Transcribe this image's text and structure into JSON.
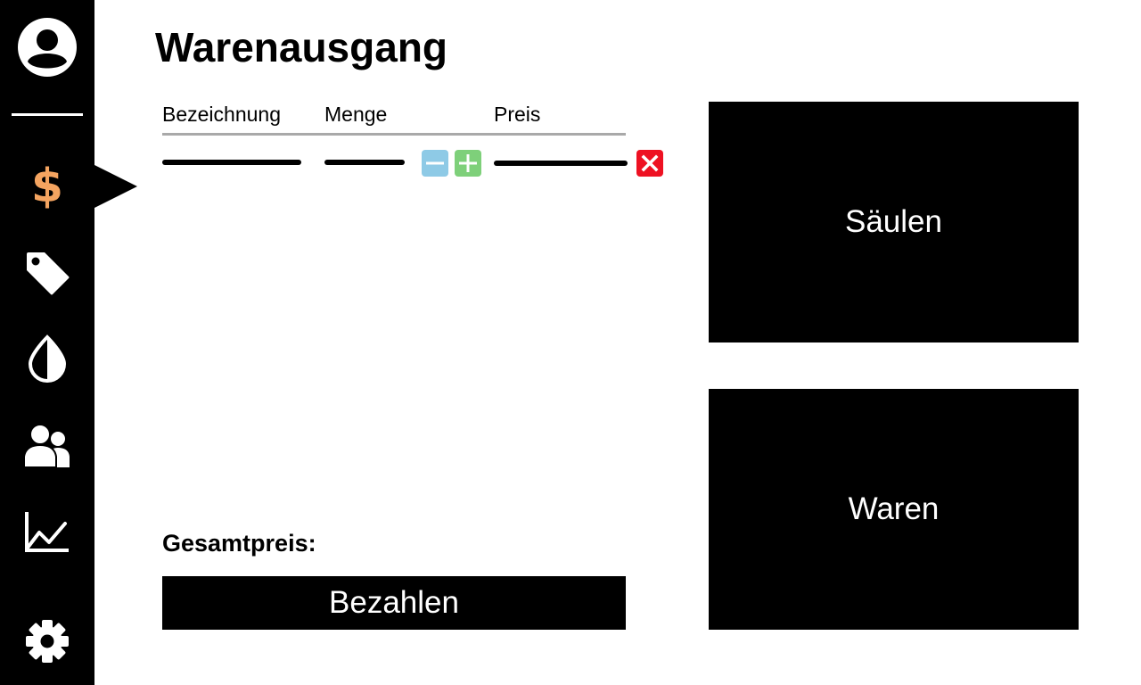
{
  "title": "Warenausgang",
  "colors": {
    "sidebar": "#000000",
    "active_icon": "#f4a460",
    "minus": "#8ecae6",
    "plus": "#7ed07a",
    "delete": "#ee1122",
    "rule": "#a9a9a9"
  },
  "sidebar": {
    "items": [
      {
        "icon": "user-profile-icon"
      },
      {
        "icon": "dollar-icon",
        "glyph": "$",
        "active": true
      },
      {
        "icon": "price-tag-icon"
      },
      {
        "icon": "drop-icon"
      },
      {
        "icon": "users-icon"
      },
      {
        "icon": "line-chart-icon"
      },
      {
        "icon": "gear-icon"
      }
    ]
  },
  "table": {
    "columns": [
      "Bezeichnung",
      "Menge",
      "Preis"
    ],
    "rows": [
      {
        "bezeichnung": "",
        "menge": "",
        "preis": ""
      }
    ]
  },
  "total": {
    "label": "Gesamtpreis:"
  },
  "pay_button": {
    "label": "Bezahlen"
  },
  "tiles": [
    {
      "label": "Säulen"
    },
    {
      "label": "Waren"
    }
  ]
}
